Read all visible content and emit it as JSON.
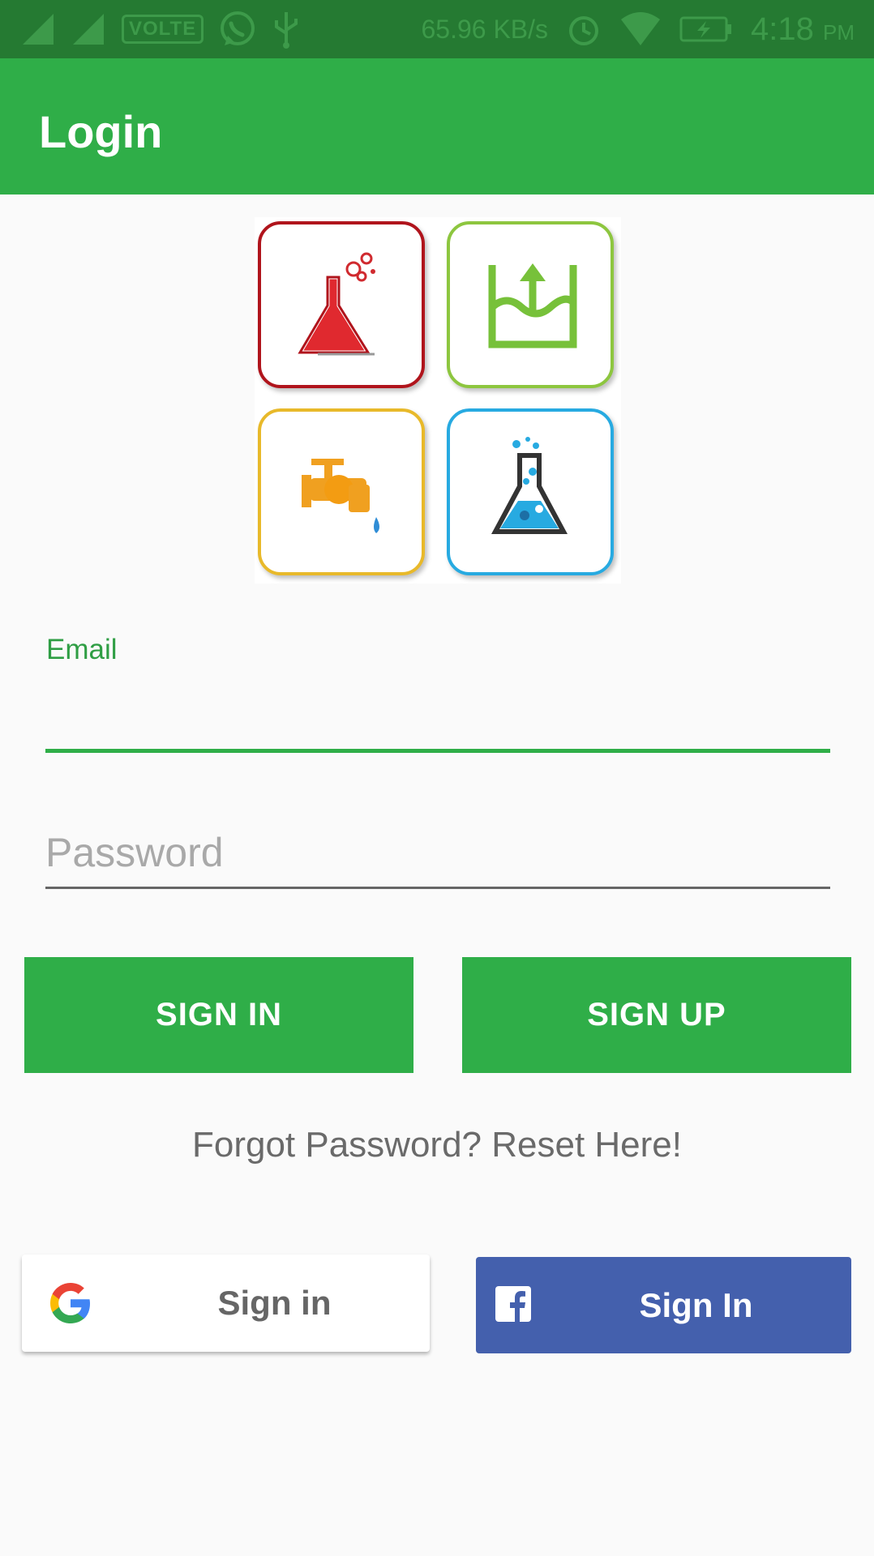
{
  "status_bar": {
    "sim1": "1",
    "sim2": "2",
    "volte": "VOLTE",
    "speed": "65.96 KB/s",
    "time": "4:18",
    "ampm": "PM"
  },
  "app_bar": {
    "title": "Login"
  },
  "form": {
    "email_label": "Email",
    "email_value": "",
    "password_placeholder": "Password",
    "sign_in_label": "SIGN IN",
    "sign_up_label": "SIGN UP",
    "forgot_text": "Forgot Password? Reset Here!"
  },
  "social": {
    "google_label": "Sign in",
    "facebook_label": "Sign In"
  },
  "colors": {
    "primary": "#2fae48",
    "status_bar": "#257a32",
    "facebook": "#4460ad"
  },
  "icons": {
    "tile1": "flask-bubbles-icon",
    "tile2": "water-level-up-icon",
    "tile3": "water-tap-icon",
    "tile4": "lab-flask-icon",
    "google": "google-g-icon",
    "facebook": "facebook-f-icon"
  }
}
